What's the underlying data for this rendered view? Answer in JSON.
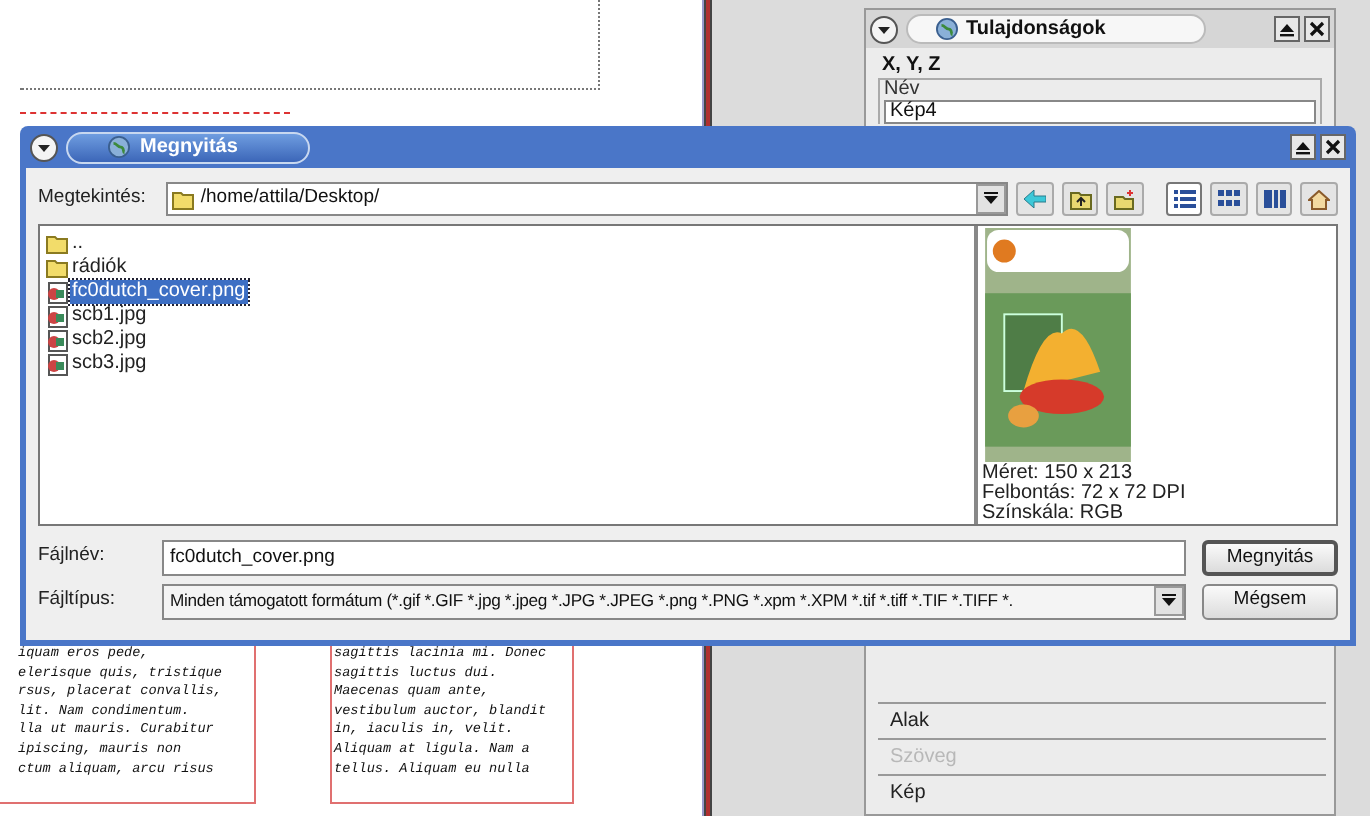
{
  "background_document": {
    "column_1_lines": [
      "iquam eros pede,",
      "elerisque quis, tristique",
      "rsus, placerat convallis,",
      "lit. Nam condimentum.",
      "lla ut mauris. Curabitur",
      "ipiscing, mauris non",
      "ctum aliquam, arcu risus"
    ],
    "column_2_lines": [
      "sagittis lacinia mi. Donec",
      "sagittis luctus dui.",
      "Maecenas quam ante,",
      "vestibulum auctor, blandit",
      "in, iaculis in, velit.",
      "Aliquam at ligula. Nam a",
      "tellus. Aliquam eu nulla"
    ]
  },
  "properties_panel": {
    "title": "Tulajdonságok",
    "tab": "X, Y, Z",
    "group_label": "Név",
    "name_value": "Kép4",
    "sections": [
      {
        "label": "Alak",
        "disabled": false
      },
      {
        "label": "Szöveg",
        "disabled": true
      },
      {
        "label": "Kép",
        "disabled": false
      }
    ]
  },
  "dialog": {
    "title": "Megnyitás",
    "look_in_label": "Megtekintés:",
    "path": "/home/attila/Desktop/",
    "view_modes": [
      {
        "kind": "detail",
        "selected": true
      },
      {
        "kind": "icons",
        "selected": false
      },
      {
        "kind": "columns",
        "selected": false
      }
    ],
    "files": [
      {
        "name": "..",
        "kind": "folder",
        "selected": false
      },
      {
        "name": "rádiók",
        "kind": "folder",
        "selected": false
      },
      {
        "name": "fc0dutch_cover.png",
        "kind": "image",
        "selected": true
      },
      {
        "name": "scb1.jpg",
        "kind": "image",
        "selected": false
      },
      {
        "name": "scb2.jpg",
        "kind": "image",
        "selected": false
      },
      {
        "name": "scb3.jpg",
        "kind": "image",
        "selected": false
      }
    ],
    "preview_info": [
      "Méret: 150 x 213",
      "Felbontás: 72 x 72 DPI",
      "Színskála: RGB"
    ],
    "filename_label": "Fájlnév:",
    "filename": "fc0dutch_cover.png",
    "filetype_label": "Fájltípus:",
    "filetype": "Minden támogatott formátum (*.gif *.GIF *.jpg *.jpeg *.JPG *.JPEG *.png *.PNG *.xpm *.XPM *.tif *.tiff *.TIF *.TIFF *.",
    "open_button": "Megnyitás",
    "cancel_button": "Mégsem"
  }
}
